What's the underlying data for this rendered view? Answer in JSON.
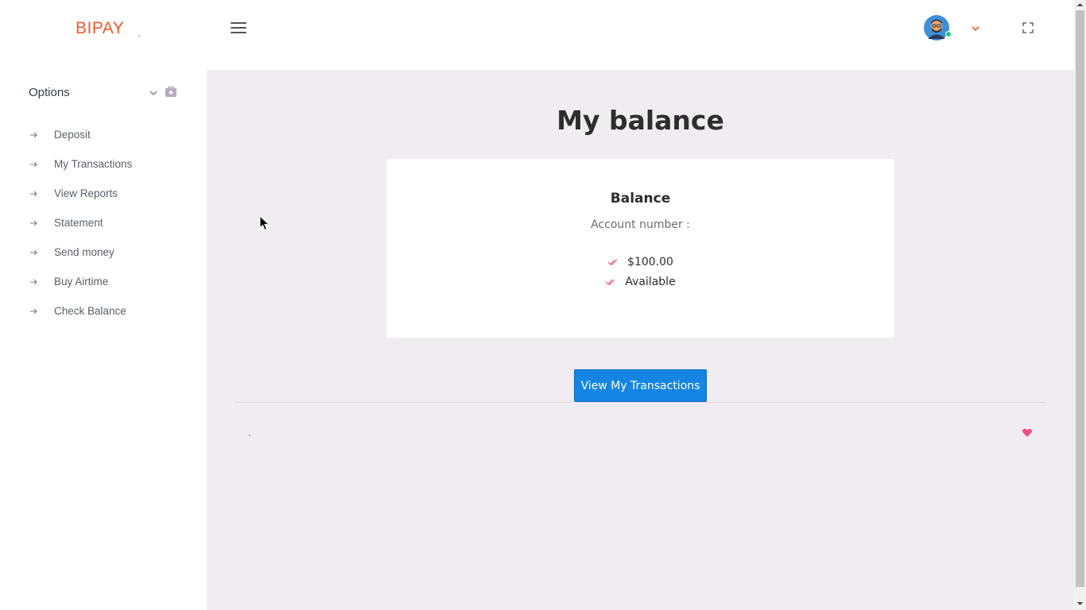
{
  "header": {
    "logo_text": "BIPAY",
    "menu_icon": "hamburger-menu-icon",
    "avatar_icon": "user-avatar-icon",
    "user_menu_icon": "chevron-down-icon",
    "fullscreen_icon": "fullscreen-icon"
  },
  "sidebar": {
    "title": "Options",
    "items": [
      {
        "label": "Deposit"
      },
      {
        "label": "My Transactions"
      },
      {
        "label": "View Reports"
      },
      {
        "label": "Statement"
      },
      {
        "label": "Send money"
      },
      {
        "label": "Buy Airtime"
      },
      {
        "label": "Check Balance"
      }
    ]
  },
  "main": {
    "page_title": "My balance",
    "card": {
      "title": "Balance",
      "account_label": "Account number :",
      "amount": "$100.00",
      "status": "Available"
    },
    "button_label": "View My Transactions"
  },
  "colors": {
    "brand": "#f15a29",
    "primary_button": "#1585e4",
    "main_background": "#f1ecf2",
    "check_icon": "#e8506e",
    "heart_icon": "#f0507a",
    "online_status": "#21c77d"
  }
}
